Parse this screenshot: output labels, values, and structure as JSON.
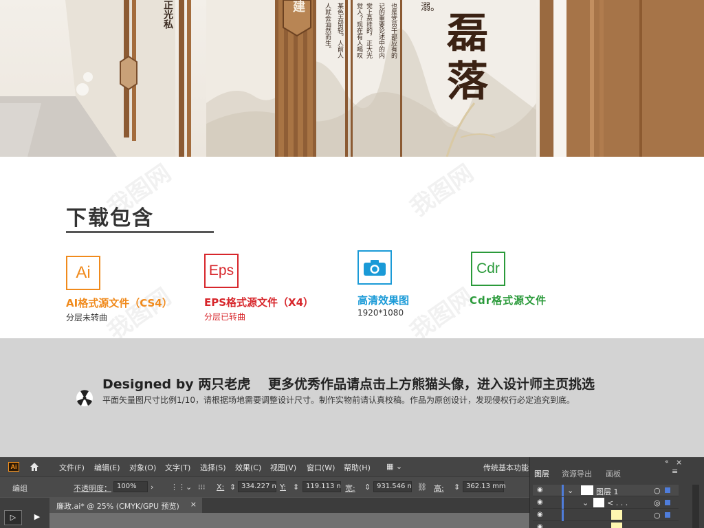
{
  "banner": {
    "big_chars": [
      "磊",
      "落"
    ],
    "jian_char": "建",
    "vertical_texts": [
      "也是党员干部应有的",
      "记的重要论述中的内",
      "觉上悬挂的，正大光",
      "觉人？现在有人喝叹",
      "某色去留轻。人前人",
      "人就会油然而生。",
      "正光私"
    ],
    "small_char": "溺。"
  },
  "download": {
    "title": "下载包含",
    "formats": [
      {
        "icon_text": "Ai",
        "name": "AI格式源文件（CS4）",
        "sub": "分层未转曲",
        "color": "#f08a1c"
      },
      {
        "icon_text": "Eps",
        "name": "EPS格式源文件（X4）",
        "sub": "分层已转曲",
        "color": "#d7262b"
      },
      {
        "icon_text": "camera-icon",
        "name": "高清效果图",
        "sub": "1920*1080",
        "color": "#1a9ad7"
      },
      {
        "icon_text": "Cdr",
        "name": "Cdr格式源文件",
        "sub": "",
        "color": "#2a9a3a"
      }
    ]
  },
  "info": {
    "designed_by": "Designed by 两只老虎",
    "more": "更多优秀作品请点击上方熊猫头像，进入设计师主页挑选",
    "notice": "平面矢量图尺寸比例1/10，请根据场地需要调整设计尺寸。制作实物前请认真校稿。作品为原创设计，发现侵权行必定追究到底。"
  },
  "illustrator": {
    "menu": [
      "文件(F)",
      "编辑(E)",
      "对象(O)",
      "文字(T)",
      "选择(S)",
      "效果(C)",
      "视图(V)",
      "窗口(W)",
      "帮助(H)"
    ],
    "workspace": "传统基本功能",
    "control": {
      "group_label": "编组",
      "opacity_label": "不透明度：",
      "opacity_value": "100%",
      "x_label": "X:",
      "x_value": "334.227 n",
      "y_label": "Y:",
      "y_value": "119.113 n",
      "w_label": "宽:",
      "w_value": "931.546 n",
      "h_label": "高:",
      "h_value": "362.13 mm"
    },
    "doc_tab": "廉政.ai* @ 25% (CMYK/GPU 预览)",
    "panel_tabs": [
      "图层",
      "资源导出",
      "画板"
    ],
    "layer_name": "图层 1",
    "sublayer_name": "< . . ."
  },
  "colors": {
    "ai_orange": "#f08a1c",
    "eps_red": "#d7262b",
    "photo_blue": "#1a9ad7",
    "cdr_green": "#2a9a3a",
    "info_band": "#d3d3d3"
  }
}
